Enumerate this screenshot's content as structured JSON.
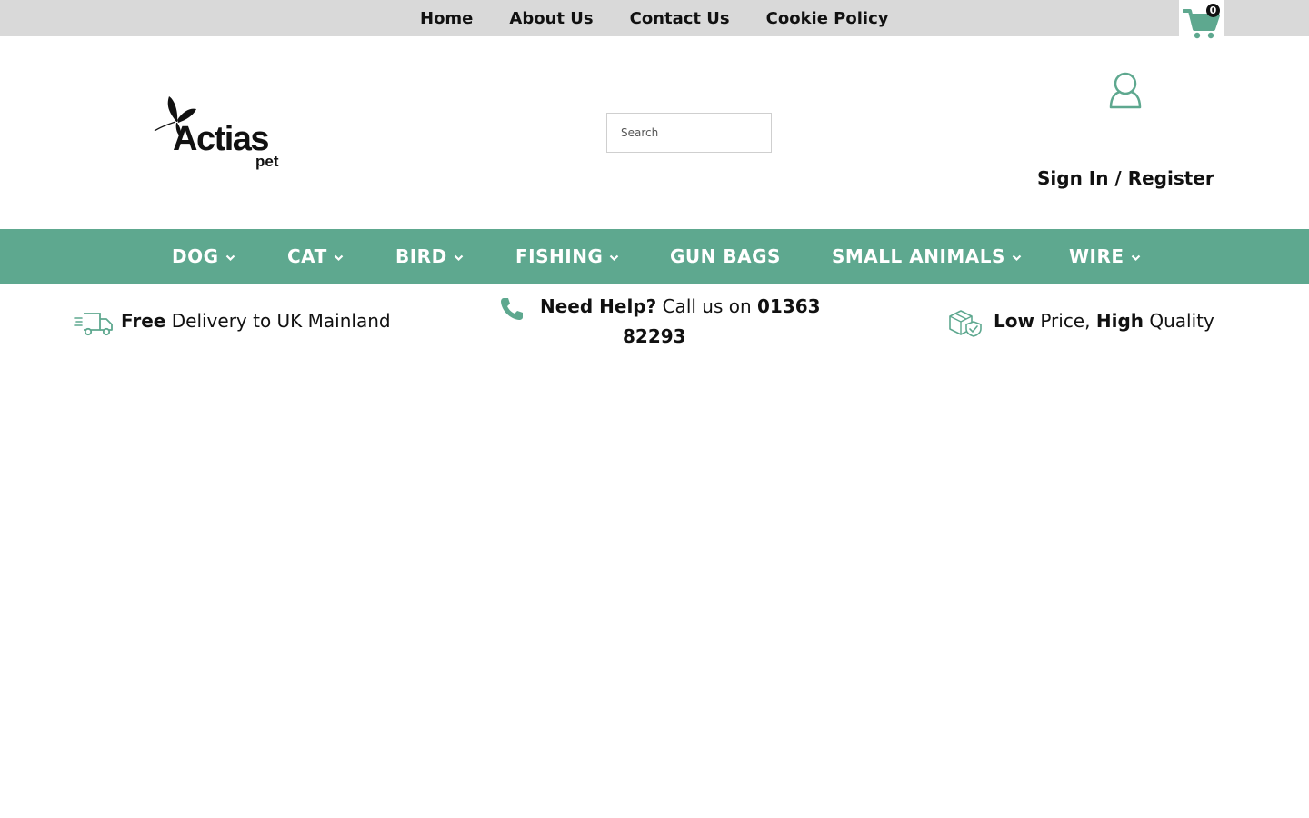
{
  "top_nav": {
    "items": [
      "Home",
      "About Us",
      "Contact Us",
      "Cookie Policy"
    ]
  },
  "cart": {
    "count": "0",
    "icon": "cart-icon"
  },
  "logo": {
    "name": "Actias",
    "sub": "pet",
    "icon": "butterfly-icon"
  },
  "search": {
    "placeholder": "Search",
    "value": ""
  },
  "account": {
    "icon": "user-icon",
    "label": "Sign In / Register"
  },
  "categories": [
    {
      "label": "DOG",
      "dropdown": true
    },
    {
      "label": "CAT",
      "dropdown": true
    },
    {
      "label": "BIRD",
      "dropdown": true
    },
    {
      "label": "FISHING",
      "dropdown": true
    },
    {
      "label": "GUN BAGS",
      "dropdown": false
    },
    {
      "label": "SMALL ANIMALS",
      "dropdown": true
    },
    {
      "label": "WIRE",
      "dropdown": true
    }
  ],
  "features": {
    "delivery": {
      "bold": "Free",
      "text": " Delivery to UK Mainland",
      "icon": "delivery-truck-icon"
    },
    "help": {
      "bold": "Need Help?",
      "text": " Call us on ",
      "phone_part1": "01363",
      "phone_part2": "82293",
      "icon": "phone-icon"
    },
    "quality": {
      "bold1": "Low",
      "text1": " Price, ",
      "bold2": "High",
      "text2": " Quality",
      "icon": "shield-box-icon"
    }
  },
  "colors": {
    "accent": "#5ea88f",
    "topbar_bg": "#d9d9d9",
    "text": "#111111"
  }
}
